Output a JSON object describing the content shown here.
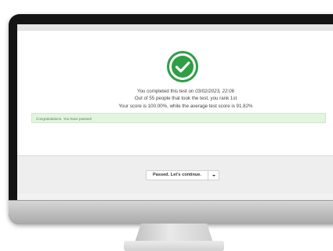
{
  "result": {
    "completed_prefix": "You completed this test on ",
    "completed_date": "03/02/2023, 22:06",
    "rank_text": "Out of 55 people that took the test, you rank 1st",
    "score_text": "Your score is 100.00%, while the average test score is 91.82%"
  },
  "alert": {
    "message": "Congratulations. You have passed!"
  },
  "actions": {
    "continue_label": "Passed. Let's continue."
  },
  "icons": {
    "status": "check-circle-icon",
    "dropdown": "caret-down-icon"
  },
  "colors": {
    "success_green": "#2f9e44",
    "alert_bg": "#e3f4e0"
  }
}
